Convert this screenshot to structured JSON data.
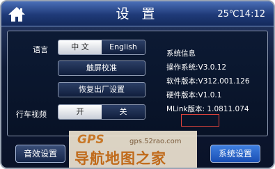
{
  "header": {
    "title": "设 置",
    "time": "25℃14:12",
    "home_icon": "home-icon"
  },
  "language": {
    "label": "语言",
    "options": [
      "中 文",
      "English"
    ],
    "selected": "中 文"
  },
  "touch_calibration_label": "触屏校准",
  "factory_reset_label": "恢复出厂设置",
  "driving_video": {
    "label": "行车视频",
    "options": [
      "开",
      "关"
    ],
    "selected": "开"
  },
  "system_info": {
    "title": "系统信息",
    "os": "操作系统:V3.0.12",
    "software": "软件版本:V312.001.126",
    "hardware": "硬件版本:V1.0.1",
    "mlink": "MLink版本: 1.0811.074"
  },
  "bottom": {
    "sound_settings_label": "音效设置",
    "system_settings_label": "系统设置"
  },
  "watermark": {
    "brand": "GPS",
    "url": "gps.52rao.com",
    "text": "导航地图之家"
  },
  "colors": {
    "accent": "#3f7fe0",
    "highlight_box": "#e0433c"
  }
}
